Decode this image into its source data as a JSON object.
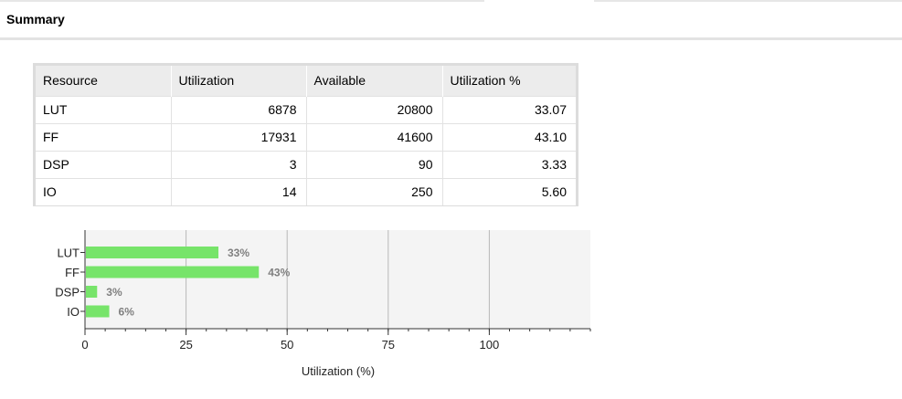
{
  "header": {
    "title": "Summary"
  },
  "table": {
    "columns": [
      "Resource",
      "Utilization",
      "Available",
      "Utilization %"
    ],
    "rows": [
      [
        "LUT",
        "6878",
        "20800",
        "33.07"
      ],
      [
        "FF",
        "17931",
        "41600",
        "43.10"
      ],
      [
        "DSP",
        "3",
        "90",
        "3.33"
      ],
      [
        "IO",
        "14",
        "250",
        "5.60"
      ]
    ]
  },
  "chart_data": {
    "type": "bar",
    "orientation": "horizontal",
    "categories": [
      "LUT",
      "FF",
      "DSP",
      "IO"
    ],
    "values": [
      33,
      43,
      3,
      6
    ],
    "data_labels": [
      "33%",
      "43%",
      "3%",
      "6%"
    ],
    "xlabel": "Utilization (%)",
    "ylabel": "",
    "xlim": [
      0,
      125
    ],
    "xticks": [
      0,
      25,
      50,
      75,
      100
    ],
    "xtick_labels": [
      "0",
      "25",
      "50",
      "75",
      "100"
    ],
    "grid": true,
    "bar_color": "#77e46a",
    "plot_background": "#f4f4f4"
  }
}
